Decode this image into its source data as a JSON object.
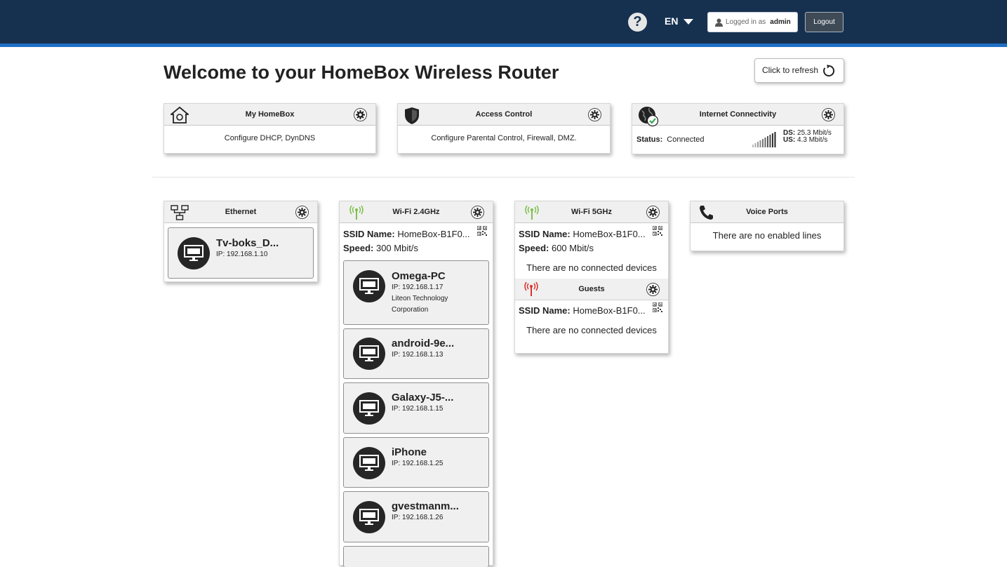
{
  "header": {
    "help_label": "?",
    "language": "EN",
    "logged_in_prefix": "Logged in as",
    "username": "admin",
    "logout_label": "Logout"
  },
  "page": {
    "title": "Welcome to your HomeBox Wireless Router",
    "refresh_label": "Click to refresh"
  },
  "summary_cards": {
    "my_homebox": {
      "title": "My HomeBox",
      "description": "Configure DHCP, DynDNS"
    },
    "access_control": {
      "title": "Access Control",
      "description": "Configure Parental Control, Firewall, DMZ."
    },
    "internet": {
      "title": "Internet Connectivity",
      "status_label": "Status:",
      "status_value": "Connected",
      "ds_label": "DS:",
      "ds_value": "25.3 Mbit/s",
      "us_label": "US:",
      "us_value": "4.3 Mbit/s"
    }
  },
  "ethernet": {
    "title": "Ethernet",
    "devices": [
      {
        "name": "Tv-boks_D...",
        "ip": "IP: 192.168.1.10"
      }
    ]
  },
  "wifi24": {
    "title": "Wi-Fi 2.4GHz",
    "ssid_label": "SSID Name:",
    "ssid_value": "HomeBox-B1F0...",
    "speed_label": "Speed:",
    "speed_value": "300 Mbit/s",
    "devices": [
      {
        "name": "Omega-PC",
        "ip": "IP: 192.168.1.17",
        "vendor": "Liteon Technology Corporation"
      },
      {
        "name": "android-9e...",
        "ip": "IP: 192.168.1.13"
      },
      {
        "name": "Galaxy-J5-...",
        "ip": "IP: 192.168.1.15"
      },
      {
        "name": "iPhone",
        "ip": "IP: 192.168.1.25"
      },
      {
        "name": "gvestmanm...",
        "ip": "IP: 192.168.1.26"
      }
    ]
  },
  "wifi5": {
    "title": "Wi-Fi 5GHz",
    "ssid_label": "SSID Name:",
    "ssid_value": "HomeBox-B1F0...",
    "speed_label": "Speed:",
    "speed_value": "600 Mbit/s",
    "no_devices": "There are no connected devices",
    "guests": {
      "title": "Guests",
      "ssid_label": "SSID Name:",
      "ssid_value": "HomeBox-B1F0...",
      "no_devices": "There are no connected devices"
    }
  },
  "voice": {
    "title": "Voice Ports",
    "message": "There are no enabled lines"
  },
  "colors": {
    "header_bg": "#163150",
    "header_stripe": "#1f6fc6",
    "wifi_active": "#7cc04b",
    "wifi_guest": "#d9322b",
    "connected_green": "#3aa655"
  },
  "signal_level": "10 of 10 bars"
}
